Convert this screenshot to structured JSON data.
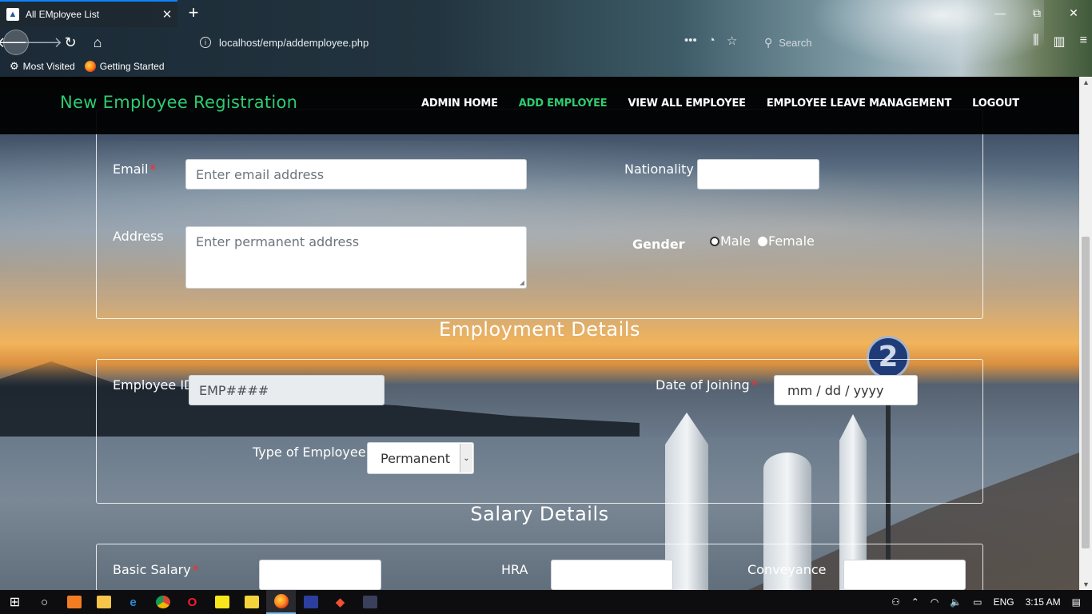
{
  "browser": {
    "tab_title": "All EMployee List",
    "tab_close": "✕",
    "new_tab": "+",
    "url": "localhost/emp/addemployee.php",
    "search_placeholder": "Search",
    "window_controls": {
      "minimize": "—",
      "maximize": "⧉",
      "close": "✕"
    },
    "bookmarks": [
      {
        "label": "Most Visited",
        "icon": "gear-icon"
      },
      {
        "label": "Getting Started",
        "icon": "firefox-icon"
      }
    ]
  },
  "site": {
    "brand": "New Employee Registration",
    "nav": [
      {
        "label": "ADMIN HOME",
        "active": false
      },
      {
        "label": "ADD EMPLOYEE",
        "active": true
      },
      {
        "label": "VIEW ALL EMPLOYEE",
        "active": false
      },
      {
        "label": "EMPLOYEE LEAVE MANAGEMENT",
        "active": false
      },
      {
        "label": "LOGOUT",
        "active": false
      }
    ],
    "accent": "#2ecc71",
    "required_color": "#ff2a2a"
  },
  "personal": {
    "email_label": "Email",
    "email_placeholder": "Enter email address",
    "nationality_label": "Nationality",
    "nationality_value": "",
    "address_label": "Address",
    "address_placeholder": "Enter permanent address",
    "gender_label": "Gender",
    "gender_options": [
      "Male",
      "Female"
    ]
  },
  "employment": {
    "title": "Employment Details",
    "employee_id_label": "Employee ID",
    "employee_id_value": "EMP####",
    "doj_label": "Date of Joining",
    "doj_placeholder": "mm / dd / yyyy",
    "type_label": "Type of Employee",
    "type_selected": "Permanent"
  },
  "salary": {
    "title": "Salary Details",
    "basic_label": "Basic Salary",
    "hra_label": "HRA",
    "conveyance_label": "Conveyance"
  },
  "background_sign": "2",
  "taskbar": {
    "language": "ENG",
    "time": "3:15 AM"
  }
}
